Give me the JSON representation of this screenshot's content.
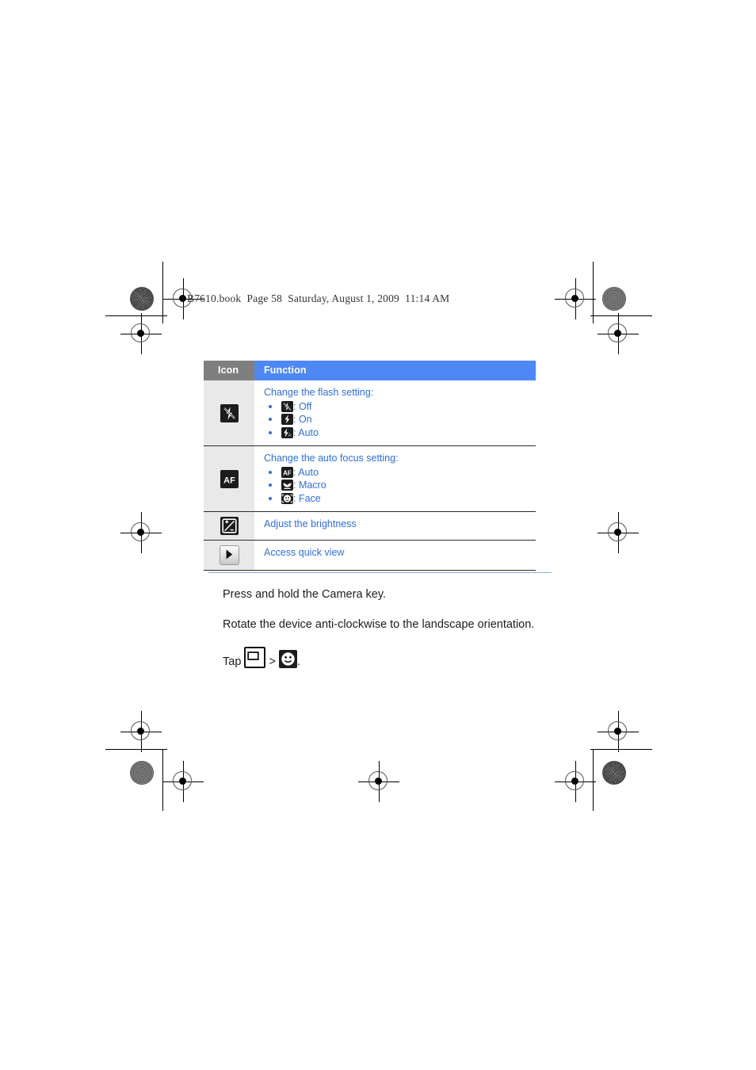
{
  "page_header": {
    "text": "B7610.book  Page 58  Saturday, August 1, 2009  11:14 AM"
  },
  "table": {
    "headers": {
      "icon": "Icon",
      "function": "Function"
    },
    "rows": [
      {
        "icon_name": "flash-off-icon",
        "title": "Change the flash setting:",
        "options": [
          {
            "icon_name": "flash-off-icon",
            "label": ": Off"
          },
          {
            "icon_name": "flash-on-icon",
            "label": ": On"
          },
          {
            "icon_name": "flash-auto-icon",
            "label": ": Auto"
          }
        ]
      },
      {
        "icon_name": "auto-focus-icon",
        "title": "Change the auto focus setting:",
        "options": [
          {
            "icon_name": "auto-focus-icon",
            "label": ": Auto"
          },
          {
            "icon_name": "macro-focus-icon",
            "label": ": Macro"
          },
          {
            "icon_name": "face-detection-icon",
            "label": ": Face"
          }
        ]
      },
      {
        "icon_name": "brightness-icon",
        "title": "Adjust the brightness",
        "options": []
      },
      {
        "icon_name": "quick-view-icon",
        "title": "Access quick view",
        "options": []
      }
    ]
  },
  "body": {
    "step_1": "Press and hold the Camera key.",
    "step_2": "Rotate the device anti-clockwise to the landscape orientation.",
    "tap_prefix": "Tap ",
    "tap_separator": " > ",
    "tap_suffix": ".",
    "tap_icon_1": "screen-rectangle-icon",
    "tap_icon_2": "smiley-face-icon"
  },
  "colors": {
    "header_gray": "#7f7f7f",
    "header_blue": "#4d88f5",
    "link_blue": "#2f6fdd",
    "rule_blue": "#8ab0ea",
    "icon_cell_bg": "#e9e9e9"
  }
}
